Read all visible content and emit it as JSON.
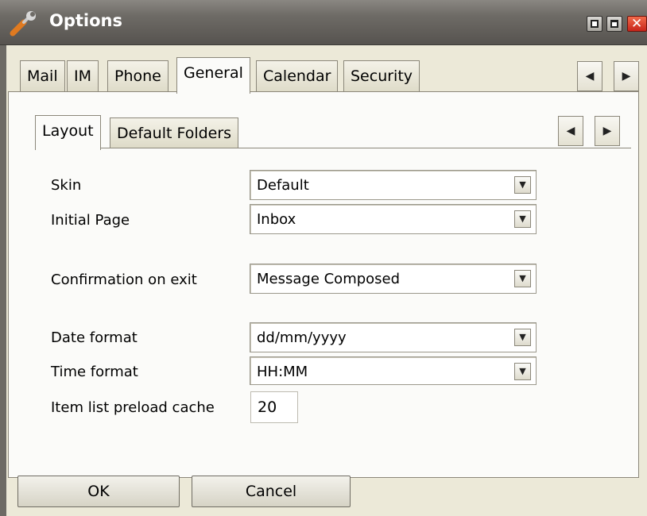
{
  "window": {
    "title": "Options"
  },
  "outer_tabs": [
    "Mail",
    "IM",
    "Phone",
    "General",
    "Calendar",
    "Security"
  ],
  "outer_active_tab": "General",
  "inner_tabs": [
    "Layout",
    "Default Folders"
  ],
  "inner_active_tab": "Layout",
  "nav_icons": {
    "left": "left-arrow-icon",
    "right": "right-arrow-icon"
  },
  "fields": {
    "skin": {
      "label": "Skin",
      "value": "Default"
    },
    "initial_page": {
      "label": "Initial Page",
      "value": "Inbox"
    },
    "confirmation": {
      "label": "Confirmation on exit",
      "value": "Message Composed"
    },
    "date_format": {
      "label": "Date format",
      "value": "dd/mm/yyyy"
    },
    "time_format": {
      "label": "Time format",
      "value": "HH:MM"
    },
    "preload_cache": {
      "label": "Item list preload cache",
      "value": "20"
    }
  },
  "buttons": {
    "ok": "OK",
    "cancel": "Cancel"
  },
  "glyphs": {
    "arrow_left": "◀",
    "arrow_right": "▶",
    "dropdown": "▼",
    "close": "✕"
  },
  "colors": {
    "titlebar": "#6e6b66",
    "close_button": "#c8251a",
    "panel_bg": "#fbfbf9",
    "window_bg": "#ece9d8"
  }
}
